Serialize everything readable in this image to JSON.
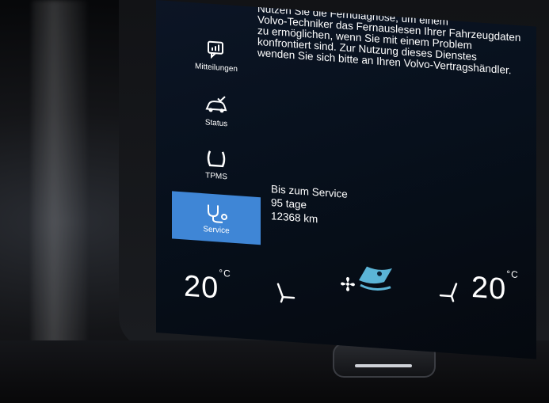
{
  "info_text": "Nutzen Sie die Ferndiagnose, um einem\nVolvo-Techniker das Fernauslesen Ihrer Fahrzeugdaten\nzu ermöglichen, wenn Sie mit einem Problem\nkonfrontiert sind. Zur Nutzung dieses Dienstes\nwenden Sie sich bitte an Ihren Volvo-Vertragshändler.",
  "sidebar": {
    "items": [
      {
        "label": "Mitteilungen",
        "icon": "messages-icon"
      },
      {
        "label": "Status",
        "icon": "car-status-icon"
      },
      {
        "label": "TPMS",
        "icon": "tire-pressure-icon"
      },
      {
        "label": "Service",
        "icon": "stethoscope-icon",
        "active": true
      }
    ]
  },
  "service": {
    "title": "Bis zum Service",
    "days": "95 tage",
    "distance": "12368 km"
  },
  "climate": {
    "left_temp": "20",
    "left_unit": "°C",
    "right_temp": "20",
    "right_unit": "°C"
  },
  "colors": {
    "accent": "#3f86d6",
    "screen_bg": "#07101c"
  }
}
